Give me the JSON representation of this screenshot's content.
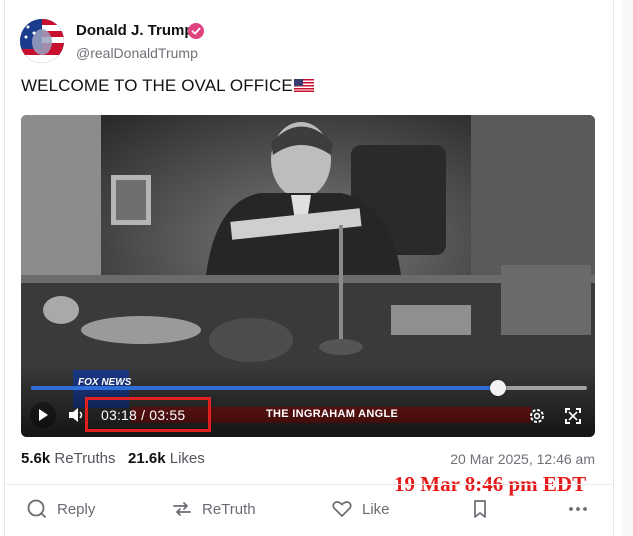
{
  "post": {
    "author_name": "Donald J. Trump",
    "handle": "@realDonaldTrump",
    "text": "WELCOME TO THE OVAL OFFICE",
    "text_emoji_icon": "us-flag-icon",
    "verified_color": "#e0437f"
  },
  "video": {
    "time_display": "03:18 / 03:55",
    "progress": 0.84,
    "progress_color": "#2f6cd7",
    "lower_third_text": "THE INGRAHAM ANGLE",
    "network_text": "FOX NEWS"
  },
  "stats": {
    "retruths_count": "5.6k",
    "retruths_label": "ReTruths",
    "likes_count": "21.6k",
    "likes_label": "Likes",
    "posted_at": "20 Mar 2025, 12:46 am"
  },
  "annotation": {
    "overlay_date": "19 Mar 8:46 pm EDT",
    "color": "#e51b1b"
  },
  "actions": {
    "reply": "Reply",
    "retruth": "ReTruth",
    "like": "Like"
  }
}
